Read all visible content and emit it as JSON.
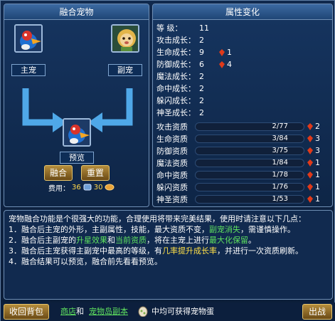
{
  "left_panel": {
    "title": "融合宠物",
    "main_label": "主宠",
    "sub_label": "副宠",
    "preview_label": "预览",
    "fuse_button": "融合",
    "reset_button": "重置",
    "cost_label": "费用：",
    "cost_value_1": "36",
    "cost_value_2": "30"
  },
  "right_panel": {
    "title": "属性变化",
    "stats": [
      {
        "name": "等    级：",
        "value": "11",
        "bonus": ""
      },
      {
        "name": "攻击成长：",
        "value": "2",
        "bonus": ""
      },
      {
        "name": "生命成长：",
        "value": "9",
        "bonus": "1"
      },
      {
        "name": "防御成长：",
        "value": "6",
        "bonus": "4"
      },
      {
        "name": "魔法成长：",
        "value": "2",
        "bonus": ""
      },
      {
        "name": "命中成长：",
        "value": "2",
        "bonus": ""
      },
      {
        "name": "躲闪成长：",
        "value": "2",
        "bonus": ""
      },
      {
        "name": "神圣成长：",
        "value": "2",
        "bonus": ""
      }
    ],
    "aptitudes": [
      {
        "name": "攻击资质",
        "value": "2/77",
        "bonus": "2"
      },
      {
        "name": "生命资质",
        "value": "3/84",
        "bonus": "3"
      },
      {
        "name": "防御资质",
        "value": "3/75",
        "bonus": "3"
      },
      {
        "name": "魔法资质",
        "value": "1/84",
        "bonus": "1"
      },
      {
        "name": "命中资质",
        "value": "1/78",
        "bonus": "1"
      },
      {
        "name": "躲闪资质",
        "value": "1/76",
        "bonus": "1"
      },
      {
        "name": "神圣资质",
        "value": "1/53",
        "bonus": "1"
      }
    ]
  },
  "description": {
    "intro": "宠物融合功能是个很强大的功能，合理使用将带来完美结果，使用时请注意以下几点：",
    "l1_a": "1．融合后主宠的外形，主副属性，技能，最大资质不变，",
    "l1_b": "副宠消失",
    "l1_c": "，需谨慎操作。",
    "l2_a": "2．融合后主副宠的",
    "l2_b": "升星效果",
    "l2_c": "和",
    "l2_d": "当前资质",
    "l2_e": "，将在主宠上进行",
    "l2_f": "最大化保留",
    "l2_g": "。",
    "l3_a": "3．融合后主宠获得主副宠中最高的等级，有",
    "l3_b": "几率提升成长率",
    "l3_c": "，并进行一次资质刷新。",
    "l4": "4．融合结果可以预览，融合前先看看预览。"
  },
  "bottom": {
    "back_button": "收回背包",
    "shop_link": "商店",
    "and_text": "和",
    "island_link": "宠物岛副本",
    "hint_text": "中均可获得宠物蛋",
    "exit_button": "出战"
  },
  "colors": {
    "highlight_green": "#5fe25f",
    "highlight_yellow": "#ffe048",
    "gem_red": "#e03a1a"
  }
}
